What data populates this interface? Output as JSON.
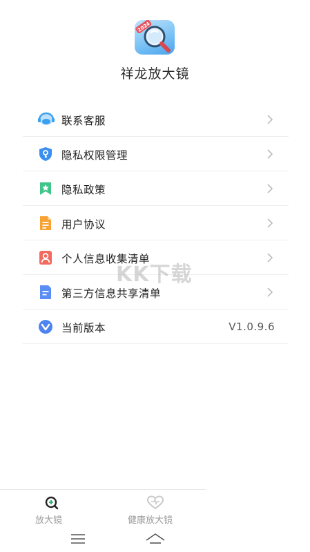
{
  "app": {
    "title": "祥龙放大镜",
    "icon": "magnifier-app-icon",
    "icon_badge": "2024"
  },
  "menu": {
    "items": [
      {
        "label": "联系客服",
        "icon": "customer-service-icon",
        "icon_color": "#3aa0f0",
        "action": "chevron-right-icon"
      },
      {
        "label": "隐私权限管理",
        "icon": "shield-key-icon",
        "icon_color": "#3b8ff0",
        "action": "chevron-right-icon"
      },
      {
        "label": "隐私政策",
        "icon": "bookmark-star-icon",
        "icon_color": "#3fc58a",
        "action": "chevron-right-icon"
      },
      {
        "label": "用户协议",
        "icon": "document-icon",
        "icon_color": "#f7a233",
        "action": "chevron-right-icon"
      },
      {
        "label": "个人信息收集清单",
        "icon": "person-card-icon",
        "icon_color": "#f26a5f",
        "action": "chevron-right-icon"
      },
      {
        "label": "第三方信息共享清单",
        "icon": "file-list-icon",
        "icon_color": "#5b8ef5",
        "action": "chevron-right-icon"
      },
      {
        "label": "当前版本",
        "icon": "version-check-icon",
        "icon_color": "#4e84f0",
        "value": "V1.0.9.6"
      }
    ]
  },
  "watermark": {
    "text": "KK下载"
  },
  "tabbar": {
    "tabs": [
      {
        "label": "放大镜",
        "icon": "magnifier-tab-icon",
        "active": true
      },
      {
        "label": "健康放大镜",
        "icon": "heart-tab-icon",
        "active": false
      }
    ]
  },
  "system_nav": {
    "menu_icon": "menu-icon",
    "home_icon": "home-icon"
  }
}
